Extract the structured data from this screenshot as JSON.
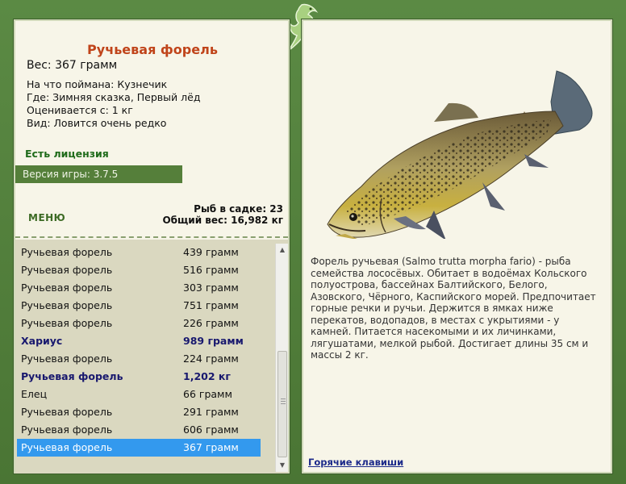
{
  "fish": {
    "name": "Ручьевая форель",
    "weight": "Вес: 367 грамм",
    "caught_on": "На что поймана: Кузнечик",
    "location": "Где: Зимняя сказка, Первый лёд",
    "valued_from": "Оценивается с: 1 кг",
    "rarity": "Вид: Ловится очень редко"
  },
  "license": "Есть лицензия",
  "version": "Версия игры: 3.7.5",
  "menu_label": "МЕНЮ",
  "stats": {
    "fish_in_cage": "Рыб в садке: 23",
    "total_weight": "Общий вес: 16,982 кг"
  },
  "catch_list": [
    {
      "name": "Ручьевая форель",
      "weight": "439 грамм",
      "style": "normal"
    },
    {
      "name": "Ручьевая форель",
      "weight": "516 грамм",
      "style": "normal"
    },
    {
      "name": "Ручьевая форель",
      "weight": "303 грамм",
      "style": "normal"
    },
    {
      "name": "Ручьевая форель",
      "weight": "751 грамм",
      "style": "normal"
    },
    {
      "name": "Ручьевая форель",
      "weight": "226 грамм",
      "style": "normal"
    },
    {
      "name": "Хариус",
      "weight": "989 грамм",
      "style": "bold"
    },
    {
      "name": "Ручьевая форель",
      "weight": "224 грамм",
      "style": "normal"
    },
    {
      "name": "Ручьевая форель",
      "weight": "1,202 кг",
      "style": "bold"
    },
    {
      "name": "Елец",
      "weight": "66 грамм",
      "style": "normal"
    },
    {
      "name": "Ручьевая форель",
      "weight": "291 грамм",
      "style": "normal"
    },
    {
      "name": "Ручьевая форель",
      "weight": "606 грамм",
      "style": "normal"
    },
    {
      "name": "Ручьевая форель",
      "weight": "367 грамм",
      "style": "selected"
    }
  ],
  "description": "Форель ручьевая (Salmo trutta morpha fario) - рыба семейства лососёвых. Обитает в водоёмах Кольского полуострова, бассейнах Балтийского, Белого, Азовского, Чёрного, Каспийского морей. Предпочитает горные речки и ручьи. Держится в ямках ниже перекатов, водопадов, в местах с укрытиями - у камней. Питается насекомыми и их личинками, лягушатами, мелкой рыбой. Достигает длины 35 см и массы 2 кг.",
  "hotkeys_label": "Горячие клавиши",
  "icons": {
    "logo": "lizard-logo-icon",
    "scroll_up": "scroll-up-arrow-icon",
    "scroll_down": "scroll-down-arrow-icon"
  },
  "colors": {
    "title": "#c0441a",
    "license": "#1f6b1a",
    "selected_row": "#3399ee",
    "bold_row": "#18186e",
    "frame": "#4f7a3a"
  }
}
